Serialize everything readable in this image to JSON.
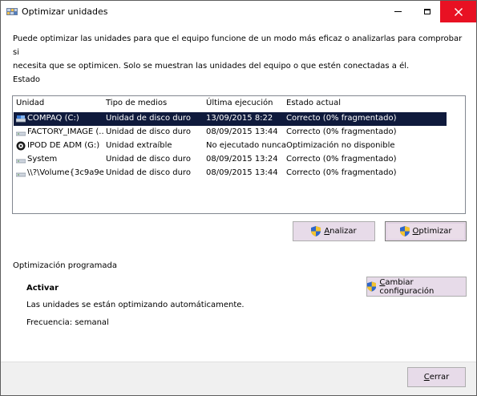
{
  "window": {
    "title": "Optimizar unidades",
    "icons": {
      "app": "defrag-app-icon",
      "minimize": "minimize-icon",
      "maximize": "maximize-icon",
      "close": "close-icon"
    }
  },
  "intro": {
    "line1": "Puede optimizar las unidades para que el equipo funcione de un modo más eficaz o analizarlas para comprobar si",
    "line2": "necesita que se optimicen. Solo se muestran las unidades del equipo o que estén conectadas a él."
  },
  "estado": {
    "label": "Estado",
    "columns": [
      "Unidad",
      "Tipo de medios",
      "Última ejecución",
      "Estado actual"
    ],
    "rows": [
      {
        "icon": "hard-drive-icon",
        "unidad": "COMPAQ (C:)",
        "tipo": "Unidad de disco duro",
        "ultima": "13/09/2015 8:22",
        "estado": "Correcto (0% fragmentado)",
        "selected": true
      },
      {
        "icon": "hard-drive-icon",
        "unidad": "FACTORY_IMAGE (...",
        "tipo": "Unidad de disco duro",
        "ultima": "08/09/2015 13:44",
        "estado": "Correcto (0% fragmentado)",
        "selected": false
      },
      {
        "icon": "removable-drive-icon",
        "unidad": "IPOD DE ADM (G:)",
        "tipo": "Unidad extraíble",
        "ultima": "No ejecutado nunca",
        "estado": "Optimización no disponible",
        "selected": false
      },
      {
        "icon": "hard-drive-icon",
        "unidad": "System",
        "tipo": "Unidad de disco duro",
        "ultima": "08/09/2015 13:24",
        "estado": "Correcto (0% fragmentado)",
        "selected": false
      },
      {
        "icon": "hard-drive-icon",
        "unidad": "\\\\?\\Volume{3c9a9e...",
        "tipo": "Unidad de disco duro",
        "ultima": "08/09/2015 13:44",
        "estado": "Correcto (0% fragmentado)",
        "selected": false
      }
    ]
  },
  "buttons": {
    "analizar": {
      "accel": "A",
      "rest": "nalizar",
      "icon": "uac-shield-icon"
    },
    "optimizar": {
      "accel": "O",
      "rest": "ptimizar",
      "icon": "uac-shield-icon"
    },
    "cambiar": {
      "accel": "C",
      "rest": "ambiar configuración",
      "icon": "uac-shield-icon"
    },
    "cerrar": {
      "accel": "C",
      "rest": "errar"
    }
  },
  "schedule": {
    "label": "Optimización programada",
    "status": "Activar",
    "description": "Las unidades se están optimizando automáticamente.",
    "frequency": "Frecuencia: semanal"
  },
  "colors": {
    "selection": "#0f1a3c",
    "button_face": "#e7dbe9",
    "close_hover": "#e81123"
  }
}
